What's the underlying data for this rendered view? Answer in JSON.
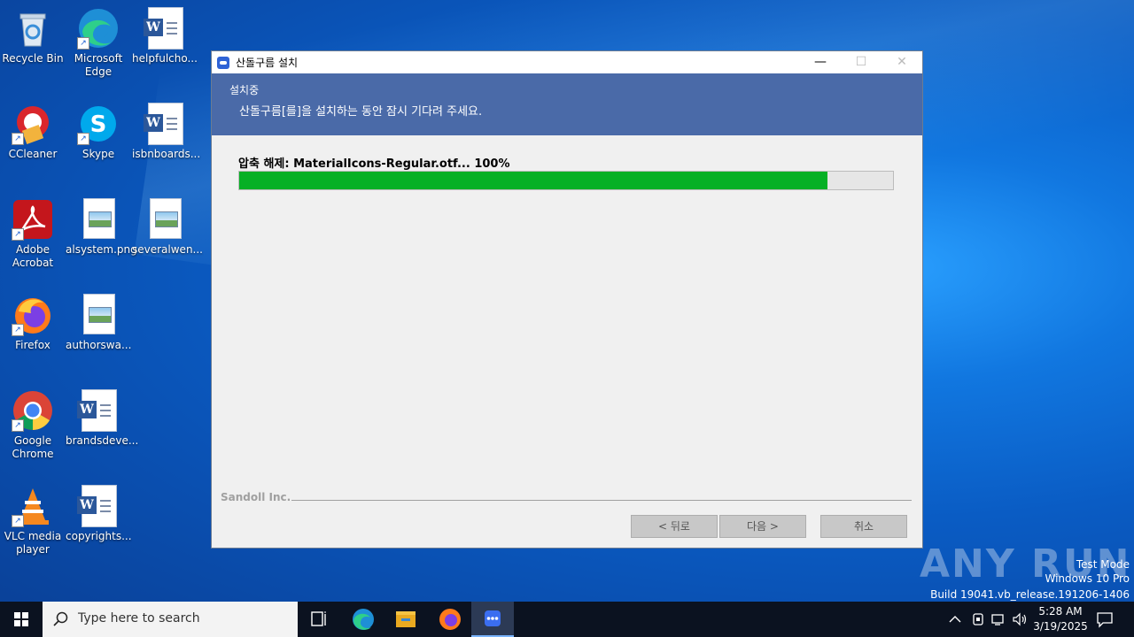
{
  "desktop": {
    "icons": [
      {
        "label": "Recycle Bin"
      },
      {
        "label": "Microsoft Edge"
      },
      {
        "label": "helpfulcho..."
      },
      {
        "label": "CCleaner"
      },
      {
        "label": "Skype"
      },
      {
        "label": "isbnboards..."
      },
      {
        "label": "Adobe Acrobat"
      },
      {
        "label": "alsystem.png"
      },
      {
        "label": "severalwen..."
      },
      {
        "label": "Firefox"
      },
      {
        "label": "authorswa..."
      },
      {
        "label": "Google Chrome"
      },
      {
        "label": "brandsdeve..."
      },
      {
        "label": "VLC media player"
      },
      {
        "label": "copyrights..."
      }
    ]
  },
  "window": {
    "title": "산돌구름 설치",
    "header_title": "설치중",
    "header_subtitle": "산돌구름[를]을 설치하는 동안 잠시 기다려 주세요.",
    "status": "압축 해제: MaterialIcons-Regular.otf... 100%",
    "progress_fraction": 0.9,
    "brand": "Sandoll Inc.",
    "buttons": {
      "back": "< 뒤로",
      "next": "다음 >",
      "cancel": "취소"
    },
    "controls": {
      "minimize": "—",
      "maximize": "☐",
      "close": "✕"
    }
  },
  "watermark": {
    "logo": "ANY RUN",
    "line1": "Test Mode",
    "line2": "Windows 10 Pro",
    "line3": "Build 19041.vb_release.191206-1406"
  },
  "taskbar": {
    "search_placeholder": "Type here to search",
    "time": "5:28 AM",
    "date": "3/19/2025"
  },
  "colors": {
    "progress": "#06b025",
    "header_band": "#4a6aa8",
    "accent": "#2f63d6"
  }
}
